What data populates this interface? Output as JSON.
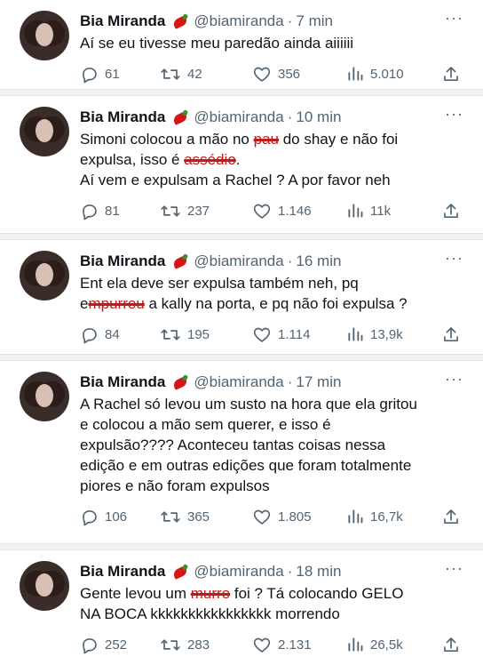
{
  "tweets": [
    {
      "name": "Bia Miranda",
      "handle": "@biamiranda",
      "separator": "·",
      "time": "7 min",
      "lines": [
        [
          {
            "t": "Aí se eu tivesse meu paredão ainda aiiiiii"
          }
        ]
      ],
      "replies": "61",
      "retweets": "42",
      "likes": "356",
      "views": "5.010"
    },
    {
      "name": "Bia Miranda",
      "handle": "@biamiranda",
      "separator": "·",
      "time": "10 min",
      "lines": [
        [
          {
            "t": "Simoni colocou a mão no "
          },
          {
            "t": "pau",
            "strike": true
          },
          {
            "t": " do shay e não foi"
          }
        ],
        [
          {
            "t": "expulsa, isso é "
          },
          {
            "t": "assédio",
            "strike": true
          },
          {
            "t": "."
          }
        ],
        [
          {
            "t": "Aí vem e expulsam a Rachel ? A por favor neh"
          }
        ]
      ],
      "replies": "81",
      "retweets": "237",
      "likes": "1.146",
      "views": "11k"
    },
    {
      "name": "Bia Miranda",
      "handle": "@biamiranda",
      "separator": "·",
      "time": "16 min",
      "lines": [
        [
          {
            "t": "Ent ela deve ser expulsa também neh, pq"
          }
        ],
        [
          {
            "t": "e"
          },
          {
            "t": "mpurrou",
            "strike": true
          },
          {
            "t": " a kally na porta, e pq não foi expulsa ?"
          }
        ]
      ],
      "replies": "84",
      "retweets": "195",
      "likes": "1.114",
      "views": "13,9k"
    },
    {
      "name": "Bia Miranda",
      "handle": "@biamiranda",
      "separator": "·",
      "time": "17 min",
      "lines": [
        [
          {
            "t": "A Rachel só levou um susto na hora que ela gritou"
          }
        ],
        [
          {
            "t": "e colocou a mão sem querer,  e isso é"
          }
        ],
        [
          {
            "t": "expulsão???? Aconteceu tantas coisas nessa"
          }
        ],
        [
          {
            "t": "edição e em outras edições que foram totalmente"
          }
        ],
        [
          {
            "t": "piores e não foram expulsos"
          }
        ]
      ],
      "replies": "106",
      "retweets": "365",
      "likes": "1.805",
      "views": "16,7k"
    },
    {
      "name": "Bia Miranda",
      "handle": "@biamiranda",
      "separator": "·",
      "time": "18 min",
      "lines": [
        [
          {
            "t": "Gente levou um "
          },
          {
            "t": "murro",
            "strike": true
          },
          {
            "t": " foi ? Tá colocando GELO"
          }
        ],
        [
          {
            "t": "NA BOCA kkkkkkkkkkkkkkkk morrendo"
          }
        ]
      ],
      "replies": "252",
      "retweets": "283",
      "likes": "2.131",
      "views": "26,5k"
    }
  ],
  "icons": {
    "reply": "reply-icon",
    "retweet": "retweet-icon",
    "like": "heart-icon",
    "views": "views-icon",
    "share": "share-icon",
    "more": "more-icon"
  },
  "colors": {
    "text": "#0f1419",
    "secondary": "#536471",
    "redaction": "#c41919",
    "separator": "#eff3f4"
  }
}
